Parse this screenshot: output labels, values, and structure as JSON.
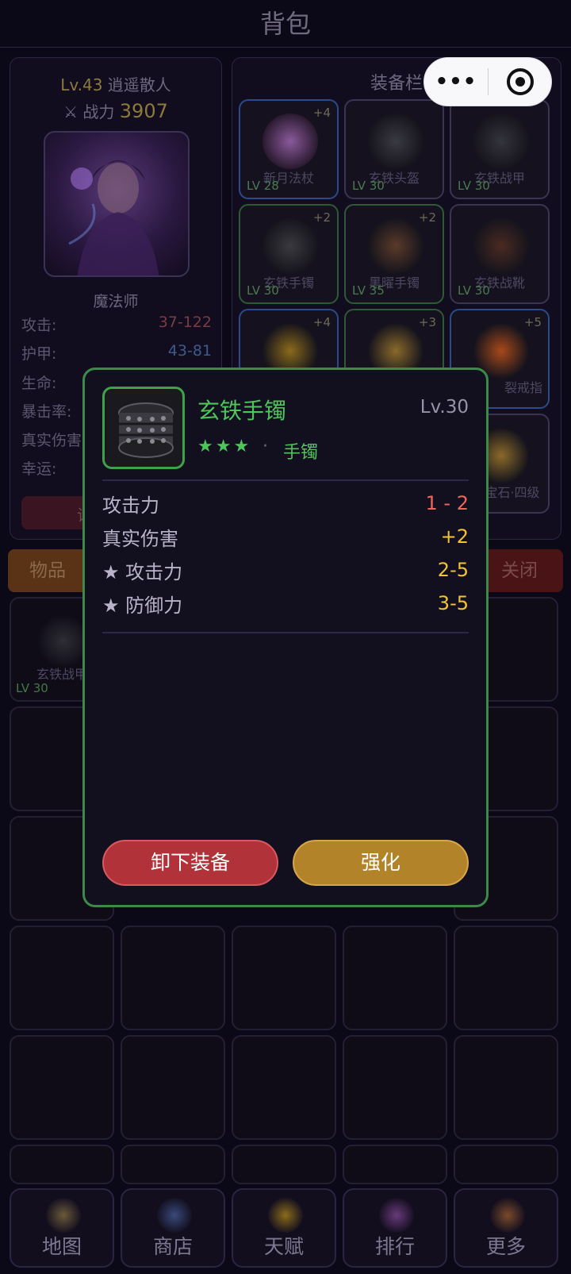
{
  "header": {
    "title": "背包"
  },
  "mini_program_capsule": {
    "more_label": "•••",
    "close_icon": "target-circle-icon"
  },
  "character": {
    "level": "Lv.43",
    "name": "逍遥散人",
    "power_label": "战力",
    "power_value": "3907",
    "class_name": "魔法师",
    "stats": [
      {
        "label": "攻击:",
        "value": "37-122"
      },
      {
        "label": "护甲:",
        "value": "43-81"
      },
      {
        "label": "生命:",
        "value": ""
      },
      {
        "label": "暴击率:",
        "value": ""
      },
      {
        "label": "真实伤害",
        "value": ""
      },
      {
        "label": "幸运:",
        "value": ""
      }
    ],
    "button_label": "详"
  },
  "equipment": {
    "title": "装备栏",
    "slots": [
      {
        "name": "新月法杖",
        "level": "LV 28",
        "plus": "+4"
      },
      {
        "name": "玄铁头盔",
        "level": "LV 30",
        "plus": ""
      },
      {
        "name": "玄铁战甲",
        "level": "LV 30",
        "plus": ""
      },
      {
        "name": "玄铁手镯",
        "level": "LV 30",
        "plus": "+2"
      },
      {
        "name": "黑曜手镯",
        "level": "LV 35",
        "plus": "+2"
      },
      {
        "name": "玄铁战靴",
        "level": "LV 30",
        "plus": ""
      },
      {
        "name": "",
        "level": "",
        "plus": "+4"
      },
      {
        "name": "",
        "level": "",
        "plus": "+3"
      },
      {
        "name": "裂戒指",
        "level": "5",
        "plus": "+5"
      },
      {
        "name": "宝石·四级",
        "level": "",
        "plus": ""
      }
    ]
  },
  "tabs": {
    "items": "物品",
    "close": "关闭"
  },
  "bag": {
    "first_item": {
      "name": "玄铁战甲",
      "level": "LV 30"
    }
  },
  "bottom_nav": [
    {
      "label": "地图",
      "icon": "map-icon"
    },
    {
      "label": "商店",
      "icon": "shop-icon"
    },
    {
      "label": "天赋",
      "icon": "talent-icon"
    },
    {
      "label": "排行",
      "icon": "ranking-icon"
    },
    {
      "label": "更多",
      "icon": "more-icon"
    }
  ],
  "item_modal": {
    "name": "玄铁手镯",
    "level": "Lv.30",
    "stars": "★★★",
    "separator": "·",
    "type": "手镯",
    "attributes": [
      {
        "label": "攻击力",
        "value": "1 - 2"
      },
      {
        "label": "真实伤害",
        "value": "+2"
      },
      {
        "label": "★ 攻击力",
        "value": "2-5"
      },
      {
        "label": "★ 防御力",
        "value": "3-5"
      }
    ],
    "unequip_label": "卸下装备",
    "enhance_label": "强化"
  },
  "colors": {
    "rarity_green": "#4fc45a",
    "value_gold": "#f2c238",
    "value_red": "#f0645c",
    "unequip_red": "#b2323a",
    "enhance_gold": "#b3832a"
  }
}
